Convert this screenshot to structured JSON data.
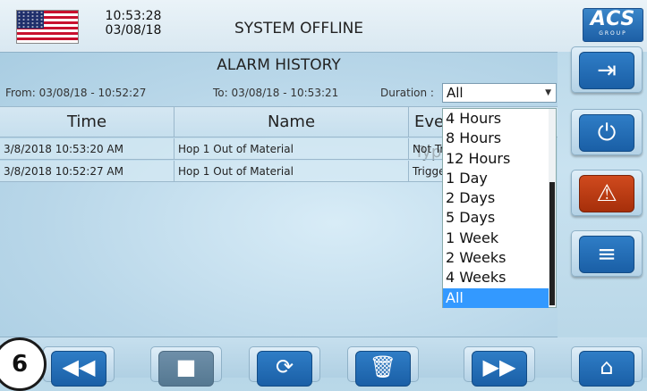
{
  "header": {
    "time": "10:53:28",
    "date": "03/08/18",
    "status": "SYSTEM OFFLINE",
    "logo_text": "ACS",
    "logo_sub": "GROUP"
  },
  "panel": {
    "title": "ALARM HISTORY",
    "from_label": "From:",
    "from_value": "03/08/18 - 10:52:27",
    "to_label": "To:",
    "to_value": "03/08/18 - 10:53:21",
    "duration_label": "Duration :",
    "duration_value": "All"
  },
  "table": {
    "columns": [
      "Time",
      "Name",
      "Event Type"
    ],
    "rows": [
      {
        "time": "3/8/2018 10:53:20 AM",
        "name": "Hop 1 Out of Material",
        "event": "Not Triggered"
      },
      {
        "time": "3/8/2018 10:52:27 AM",
        "name": "Hop 1 Out of Material",
        "event": "Triggered"
      }
    ]
  },
  "dropdown": {
    "options": [
      "4 Hours",
      "8 Hours",
      "12 Hours",
      "1 Day",
      "2 Days",
      "5 Days",
      "1 Week",
      "2 Weeks",
      "4 Weeks",
      "All"
    ],
    "selected": "All"
  },
  "side_buttons": [
    {
      "icon": "login-icon",
      "glyph": "⇥"
    },
    {
      "icon": "power-icon",
      "glyph": "⏻"
    },
    {
      "icon": "warning-icon",
      "glyph": "⚠"
    },
    {
      "icon": "menu-icon",
      "glyph": "≡"
    }
  ],
  "bottom_buttons": [
    {
      "icon": "rewind-icon",
      "glyph": "◀◀"
    },
    {
      "icon": "stop-icon",
      "glyph": "■"
    },
    {
      "icon": "refresh-icon",
      "glyph": "⟳"
    },
    {
      "icon": "trash-icon",
      "glyph": "🗑"
    },
    {
      "icon": "fast-forward-icon",
      "glyph": "▶▶"
    },
    {
      "icon": "home-icon",
      "glyph": "⌂"
    }
  ],
  "step_badge": "6",
  "colors": {
    "accent_blue": "#1a5fa6",
    "alarm_red": "#c0391a",
    "selection_blue": "#3399ff"
  }
}
